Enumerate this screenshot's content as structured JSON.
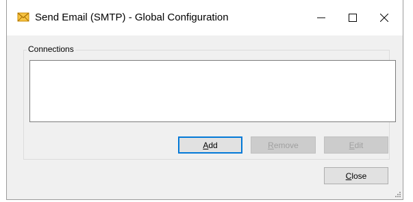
{
  "window": {
    "title": "Send Email (SMTP) - Global Configuration",
    "icon": "email-envelope-icon",
    "controls": [
      "minimize-icon",
      "maximize-icon",
      "close-icon"
    ]
  },
  "connections": {
    "group_label": "Connections",
    "items": []
  },
  "buttons": {
    "add": {
      "accel": "A",
      "rest": "dd",
      "enabled": true
    },
    "remove": {
      "accel": "R",
      "rest": "emove",
      "enabled": false
    },
    "edit": {
      "accel": "E",
      "rest": "dit",
      "enabled": false
    },
    "close": {
      "accel": "C",
      "rest": "lose",
      "enabled": true
    }
  },
  "colors": {
    "accent": "#0078d7",
    "icon": "#e5a400"
  }
}
